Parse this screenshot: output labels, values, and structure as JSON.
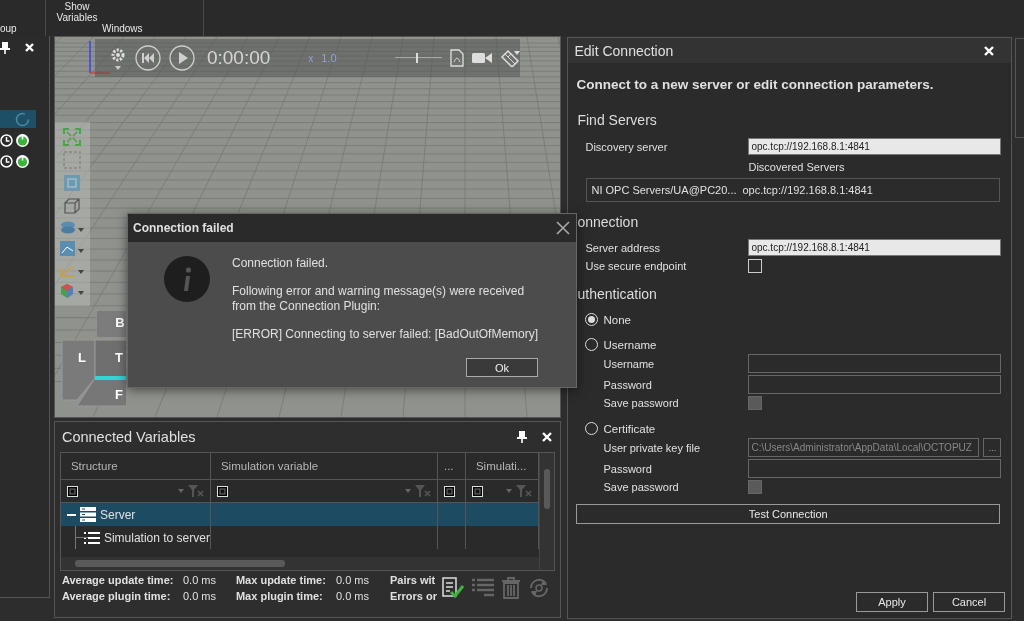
{
  "ribbon": {
    "groups": [
      {
        "label": "oup"
      },
      {
        "label": "Windows",
        "buttons": [
          "Show Variables"
        ]
      }
    ]
  },
  "left_panel": {
    "rows": [
      {
        "kind": "busy",
        "selected": true
      },
      {
        "kind": "running",
        "selected": false
      },
      {
        "kind": "running",
        "selected": false
      }
    ]
  },
  "viewport": {
    "time": "0:00:00",
    "speed_prefix": "x",
    "speed": "1.0",
    "slider": {
      "level": 0.45
    },
    "view_cube": {
      "faces": [
        "B",
        "L",
        "T",
        "F"
      ]
    }
  },
  "dialog": {
    "title": "Connection failed",
    "lines": [
      "Connection failed.",
      "Following error and warning message(s) were received from the Connection Plugin:",
      "[ERROR] Connecting to server failed: [BadOutOfMemory]"
    ],
    "button": "Ok"
  },
  "connected_variables": {
    "title": "Connected Variables",
    "columns": [
      "Structure",
      "Simulation variable",
      "...",
      "Simulati..."
    ],
    "rows": [
      {
        "label": "Server",
        "selected": true,
        "expanded": true,
        "children": [
          {
            "label": "Simulation to server",
            "selected": false
          }
        ]
      }
    ],
    "stats": [
      {
        "label": "Average update time:",
        "value": "0.0 ms"
      },
      {
        "label": "Max update time:",
        "value": "0.0 ms"
      },
      {
        "label": "Pairs wit"
      },
      {
        "label": "Average plugin time:",
        "value": "0.0 ms"
      },
      {
        "label": "Max plugin time:",
        "value": "0.0 ms"
      },
      {
        "label": "Errors or"
      }
    ]
  },
  "edit_connection": {
    "title": "Edit Connection",
    "subtitle": "Connect to a new server or edit connection parameters.",
    "find_servers": {
      "heading": "Find Servers",
      "discovery_label": "Discovery server",
      "discovery_value": "opc.tcp://192.168.8.1:4841",
      "discovered_label": "Discovered Servers",
      "servers": [
        {
          "name": "NI OPC Servers/UA@PC20...",
          "url": "opc.tcp://192.168.8.1:4841",
          "selected": false
        }
      ]
    },
    "connection": {
      "heading": "onnection",
      "server_label": "Server address",
      "server_value": "opc.tcp://192.168.8.1:4841",
      "secure_label": "Use secure endpoint",
      "secure_checked": false
    },
    "authentication": {
      "heading": "uthentication",
      "options": [
        {
          "label": "None",
          "selected": true
        },
        {
          "label": "Username",
          "selected": false,
          "fields": [
            {
              "kind": "text",
              "label": "Username"
            },
            {
              "kind": "password",
              "label": "Password"
            },
            {
              "kind": "checkbox",
              "label": "Save password",
              "checked": false,
              "disabled": true
            }
          ]
        },
        {
          "label": "Certificate",
          "selected": false,
          "fields": [
            {
              "kind": "file",
              "label": "User private key file",
              "value": "C:\\Users\\Administrator\\AppData\\Local\\OCTOPUZ",
              "disabled": true,
              "browse": "..."
            },
            {
              "kind": "password",
              "label": "Password"
            },
            {
              "kind": "checkbox",
              "label": "Save password",
              "checked": false,
              "disabled": true
            }
          ]
        }
      ]
    },
    "test_button": "Test Connection",
    "buttons": [
      "Apply",
      "Cancel"
    ]
  }
}
